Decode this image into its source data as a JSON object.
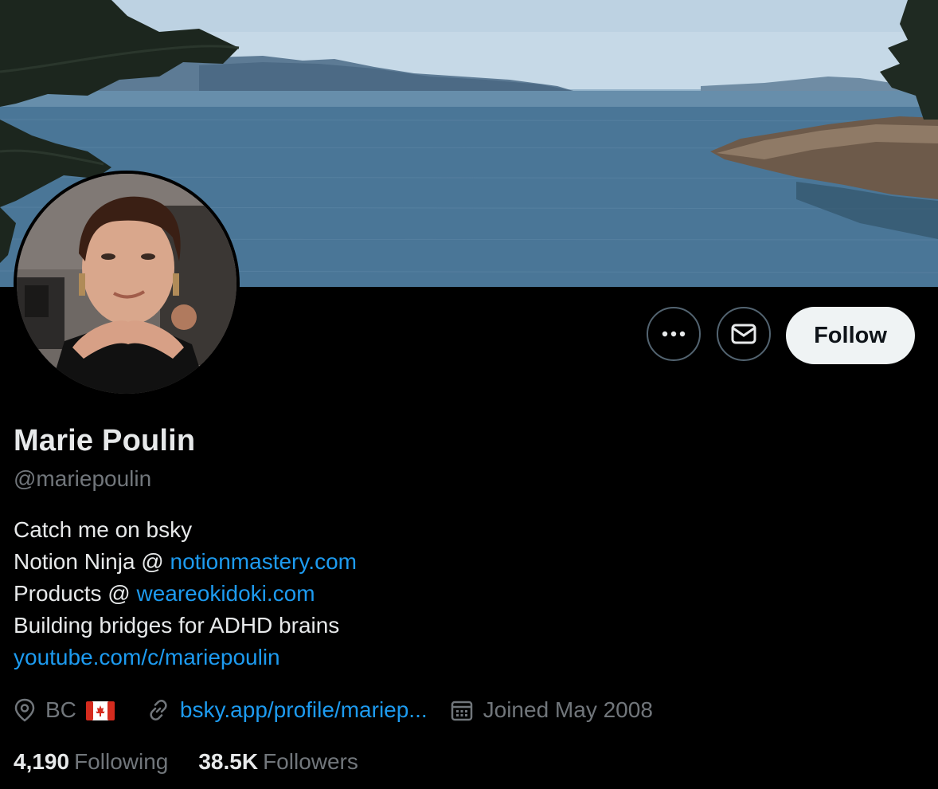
{
  "profile": {
    "display_name": "Marie Poulin",
    "handle": "@mariepoulin",
    "bio": {
      "line1": "Catch me on bsky",
      "line2_prefix": "Notion Ninja @ ",
      "line2_link": "notionmastery.com",
      "line3_prefix": "Products @ ",
      "line3_link": "weareokidoki.com",
      "line4": "Building bridges for ADHD brains",
      "line5_link": "youtube.com/c/mariepoulin"
    },
    "location": "BC",
    "location_flag_icon": "canada-flag-icon",
    "website": "bsky.app/profile/mariep...",
    "joined": "Joined May 2008"
  },
  "stats": {
    "following_count": "4,190",
    "following_label": "Following",
    "followers_count": "38.5K",
    "followers_label": "Followers"
  },
  "actions": {
    "more_icon": "ellipsis-icon",
    "message_icon": "envelope-icon",
    "follow_label": "Follow"
  },
  "colors": {
    "background": "#000000",
    "text_primary": "#e7e9ea",
    "text_secondary": "#71767b",
    "link": "#1d9bf0",
    "follow_button_bg": "#eff3f4",
    "button_border": "#536471"
  }
}
